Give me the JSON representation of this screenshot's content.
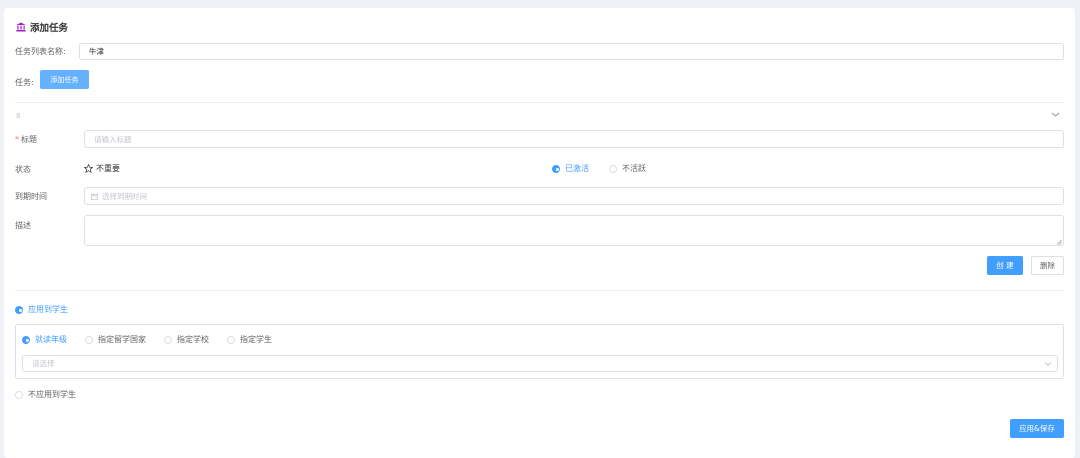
{
  "header": {
    "title": "添加任务",
    "icon": "bank-icon",
    "icon_color": "#a020c0"
  },
  "list_name": {
    "label": "任务列表名称:",
    "value": "牛津"
  },
  "tasks": {
    "label": "任务:",
    "add_button": "添加任务"
  },
  "task_panel": {
    "index": "8",
    "title": {
      "label": "标题",
      "required_mark": "*",
      "placeholder": "请输入标题"
    },
    "status": {
      "label": "状态",
      "star_label": "不重要",
      "options": [
        "已激活",
        "不活跃"
      ],
      "selected": "已激活"
    },
    "due": {
      "label": "到期时间",
      "placeholder": "选择到期时间"
    },
    "description": {
      "label": "描述",
      "value": ""
    },
    "create_button": "创 建",
    "delete_button": "删除"
  },
  "apply": {
    "option_apply": "应用到学生",
    "option_not_apply": "不应用到学生",
    "selected": "应用到学生",
    "targets": [
      "就读年级",
      "指定留学国家",
      "指定学校",
      "指定学生"
    ],
    "target_selected": "就读年级",
    "select_placeholder": "请选择"
  },
  "save_button": "应用&保存",
  "colors": {
    "primary": "#409eff",
    "primary_light": "#66b1ff",
    "border": "#dcdfe6",
    "danger": "#f56c6c"
  }
}
